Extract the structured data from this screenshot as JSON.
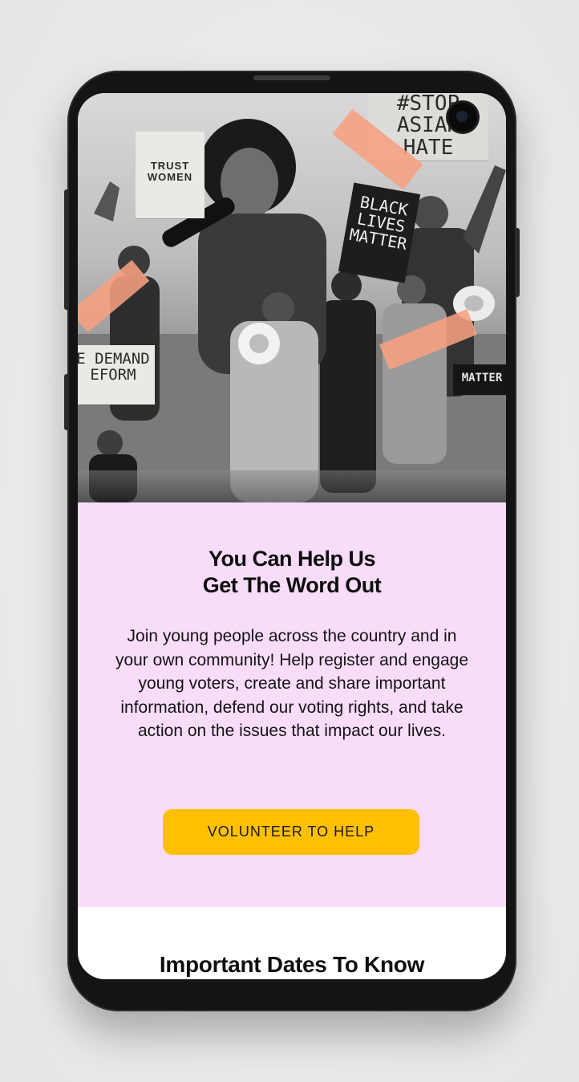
{
  "hero": {
    "signs": {
      "trust": "TRUST\nWOMEN",
      "stop": "#STOP\nASIAN\nHATE",
      "blm": "BLACK\nLIVES\nMATTER",
      "reform": "E DEMAND\nEFORM",
      "matter": "MATTER"
    }
  },
  "section": {
    "title": "You Can Help Us\nGet The Word Out",
    "body": "Join young people across the country and in your own community! Help register and engage young voters, create and share important information, defend our voting rights, and take action on the issues that impact our lives.",
    "cta_label": "VOLUNTEER TO HELP"
  },
  "dates": {
    "title": "Important Dates To Know"
  },
  "colors": {
    "pink_bg": "#f8dcf9",
    "cta_bg": "#fec000",
    "tape": "#f6a080"
  }
}
